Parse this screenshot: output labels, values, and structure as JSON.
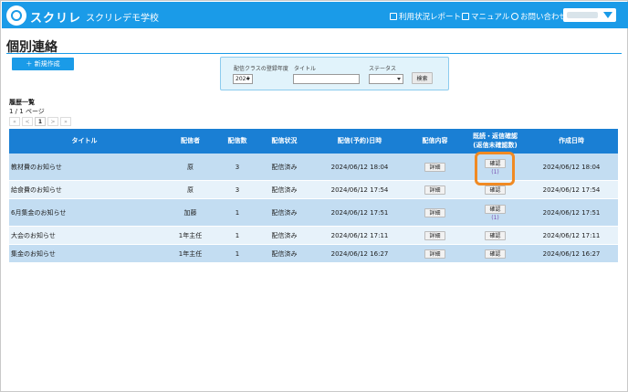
{
  "header": {
    "logo": "スクリレ",
    "school": "スクリレデモ学校",
    "links": [
      "利用状況レポート",
      "マニュアル",
      "お問い合わせ"
    ]
  },
  "page": {
    "title": "個別連絡",
    "new_button": "＋ 新規作成",
    "history_label": "履歴一覧",
    "page_info": "1 / 1 ページ",
    "pager": [
      "«",
      "<",
      "1",
      ">",
      "»"
    ]
  },
  "filter": {
    "year_label": "配信クラスの登録年度",
    "year_value": "2024",
    "title_label": "タイトル",
    "title_value": "",
    "status_label": "ステータス",
    "status_value": "",
    "search_button": "検索"
  },
  "table": {
    "headers": {
      "title": "タイトル",
      "sender": "配信者",
      "count": "配信数",
      "status": "配信状況",
      "datetime": "配信(予約)日時",
      "content": "配信内容",
      "confirm_line1": "既読・返信確認",
      "confirm_line2": "(返信未確認数)",
      "created": "作成日時"
    },
    "detail_label": "詳細",
    "confirm_label": "確認",
    "rows": [
      {
        "title": "教材費のお知らせ",
        "sender": "原",
        "count": "3",
        "status": "配信済み",
        "datetime": "2024/06/12 18:04",
        "unread": "(1)",
        "created": "2024/06/12 18:04"
      },
      {
        "title": "給食費のお知らせ",
        "sender": "原",
        "count": "3",
        "status": "配信済み",
        "datetime": "2024/06/12 17:54",
        "unread": "",
        "created": "2024/06/12 17:54"
      },
      {
        "title": "6月集金のお知らせ",
        "sender": "加藤",
        "count": "1",
        "status": "配信済み",
        "datetime": "2024/06/12 17:51",
        "unread": "(1)",
        "created": "2024/06/12 17:51"
      },
      {
        "title": "大会のお知らせ",
        "sender": "1年主任",
        "count": "1",
        "status": "配信済み",
        "datetime": "2024/06/12 17:11",
        "unread": "",
        "created": "2024/06/12 17:11"
      },
      {
        "title": "集金のお知らせ",
        "sender": "1年主任",
        "count": "1",
        "status": "配信済み",
        "datetime": "2024/06/12 16:27",
        "unread": "",
        "created": "2024/06/12 16:27"
      }
    ]
  },
  "colors": {
    "accent": "#1a9be8",
    "table_header": "#1a7fd4",
    "row_dark": "#c3ddf2",
    "row_light": "#e7f2fa",
    "highlight": "#f08a23"
  }
}
